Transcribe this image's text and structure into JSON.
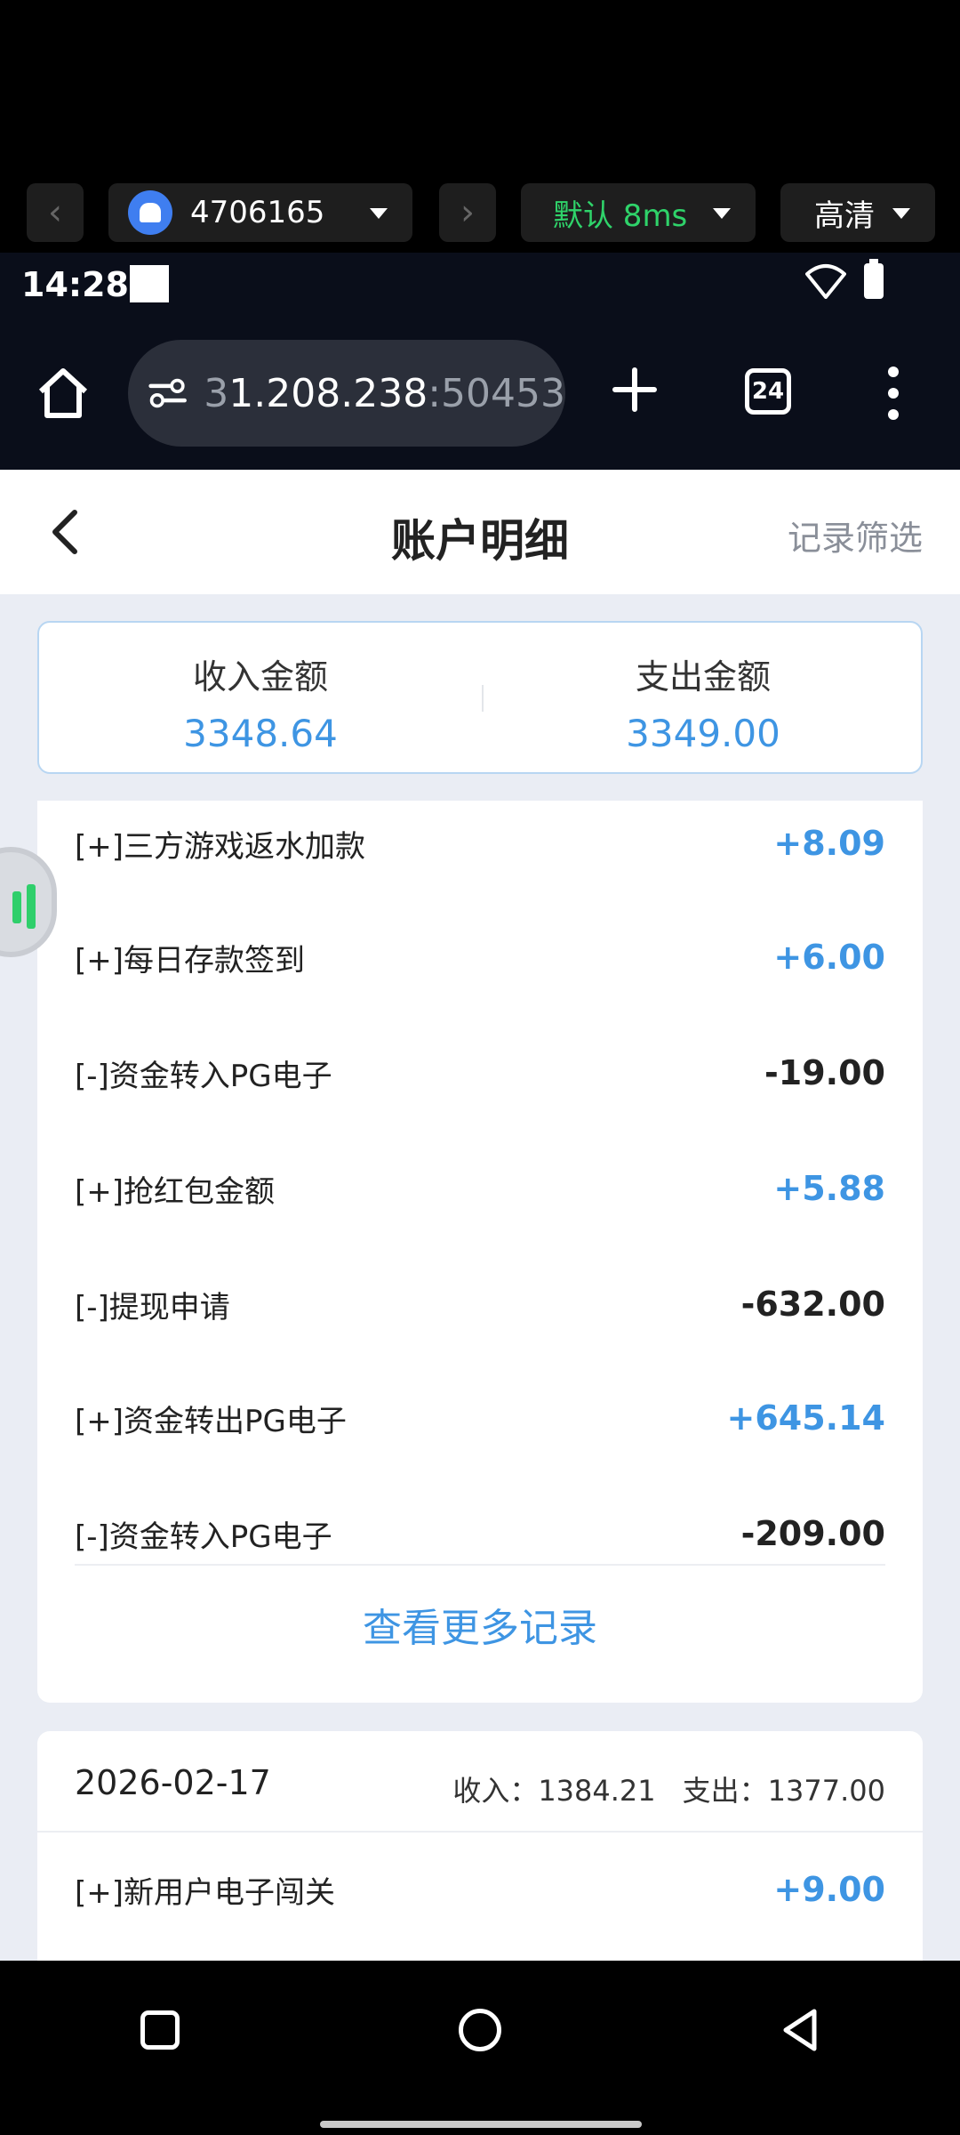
{
  "remote_toolbar": {
    "device_id": "4706165",
    "latency": "默认 8ms",
    "quality": "高清"
  },
  "status_bar": {
    "time": "14:28"
  },
  "browser": {
    "url_main": "1.208.238",
    "url_port": ":50453",
    "url_prefix": "3",
    "tab_count": "24"
  },
  "header": {
    "title": "账户明细",
    "filter": "记录筛选"
  },
  "summary": {
    "income_label": "收入金额",
    "income_value": "3348.64",
    "expense_label": "支出金额",
    "expense_value": "3349.00"
  },
  "records": [
    {
      "label": "[+]三方游戏返水加款",
      "amount": "+8.09",
      "type": "pos"
    },
    {
      "label": "[+]每日存款签到",
      "amount": "+6.00",
      "type": "pos"
    },
    {
      "label": "[-]资金转入PG电子",
      "amount": "-19.00",
      "type": "neg"
    },
    {
      "label": "[+]抢红包金额",
      "amount": "+5.88",
      "type": "pos"
    },
    {
      "label": "[-]提现申请",
      "amount": "-632.00",
      "type": "neg"
    },
    {
      "label": "[+]资金转出PG电子",
      "amount": "+645.14",
      "type": "pos"
    },
    {
      "label": "[-]资金转入PG电子",
      "amount": "-209.00",
      "type": "neg"
    }
  ],
  "more_records": "查看更多记录",
  "day2": {
    "date": "2026-02-17",
    "income": "收入：1384.21",
    "expense": "支出：1377.00",
    "first_record": {
      "label": "[+]新用户电子闯关",
      "amount": "+9.00",
      "type": "pos"
    }
  },
  "colors": {
    "accent": "#3e95e3",
    "positive": "#3e95e3",
    "negative": "#222222",
    "latency_green": "#2fd36a"
  }
}
